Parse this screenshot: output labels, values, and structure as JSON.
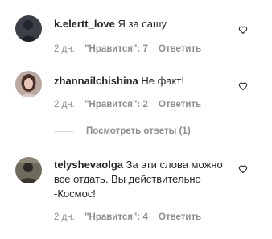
{
  "comments": [
    {
      "username": "k.elertt_love",
      "text": "Я за сашу",
      "time": "2 дн.",
      "likes": "\"Нравится\": 7",
      "reply": "Ответить"
    },
    {
      "username": "zhannailchishina",
      "text": "Не факт!",
      "time": "2 дн.",
      "likes": "\"Нравится\": 2",
      "reply": "Ответить",
      "view_replies": "Посмотреть ответы (1)"
    },
    {
      "username": "telyshevaolga",
      "text": "За эти слова можно все отдать. Вы действительно -Космос!",
      "time": "2 дн.",
      "likes": "\"Нравится\": 4",
      "reply": "Ответить"
    }
  ],
  "icons": {
    "like": "heart-outline-icon"
  },
  "colors": {
    "text": "#262626",
    "secondary": "#8e8e8e",
    "divider": "#dbdbdb"
  }
}
